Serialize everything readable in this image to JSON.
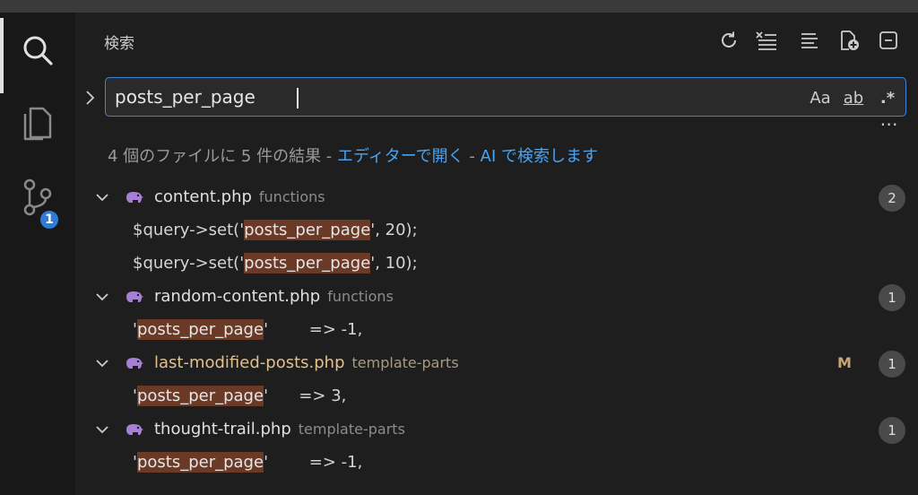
{
  "panel": {
    "title": "検索",
    "toolbar": [
      "refresh-icon",
      "clear-results-icon",
      "view-as-tree-icon",
      "new-search-editor-icon",
      "collapse-all-icon"
    ]
  },
  "search": {
    "value": "posts_per_page",
    "options": {
      "match_case": "Aa",
      "whole_word": "ab",
      "regex": ".*"
    }
  },
  "summary": {
    "text": "4 個のファイルに 5 件の結果 - ",
    "open_in_editor": "エディターで開く",
    "separator": " - ",
    "ai_search": "AI で検索します"
  },
  "activity_bar": {
    "items": [
      "search-icon",
      "explorer-icon",
      "source-control-icon"
    ],
    "scm_badge": "1"
  },
  "colors": {
    "accent": "#3a86d9",
    "highlight": "#6b3a26",
    "modified": "#e2c08d",
    "link": "#4aa3f0"
  },
  "results": [
    {
      "file": "content.php",
      "dir": "functions",
      "modified": "",
      "count": "2",
      "matches": [
        {
          "before": "$query->set('",
          "match": "posts_per_page",
          "after": "', 20);"
        },
        {
          "before": "$query->set('",
          "match": "posts_per_page",
          "after": "', 10);"
        }
      ]
    },
    {
      "file": "random-content.php",
      "dir": "functions",
      "modified": "",
      "count": "1",
      "matches": [
        {
          "before": "'",
          "match": "posts_per_page",
          "after": "'        => -1,"
        }
      ]
    },
    {
      "file": "last-modified-posts.php",
      "dir": "template-parts",
      "modified": "M",
      "count": "1",
      "matches": [
        {
          "before": "'",
          "match": "posts_per_page",
          "after": "'      => 3,"
        }
      ]
    },
    {
      "file": "thought-trail.php",
      "dir": "template-parts",
      "modified": "",
      "count": "1",
      "matches": [
        {
          "before": "'",
          "match": "posts_per_page",
          "after": "'        => -1,"
        }
      ]
    }
  ]
}
